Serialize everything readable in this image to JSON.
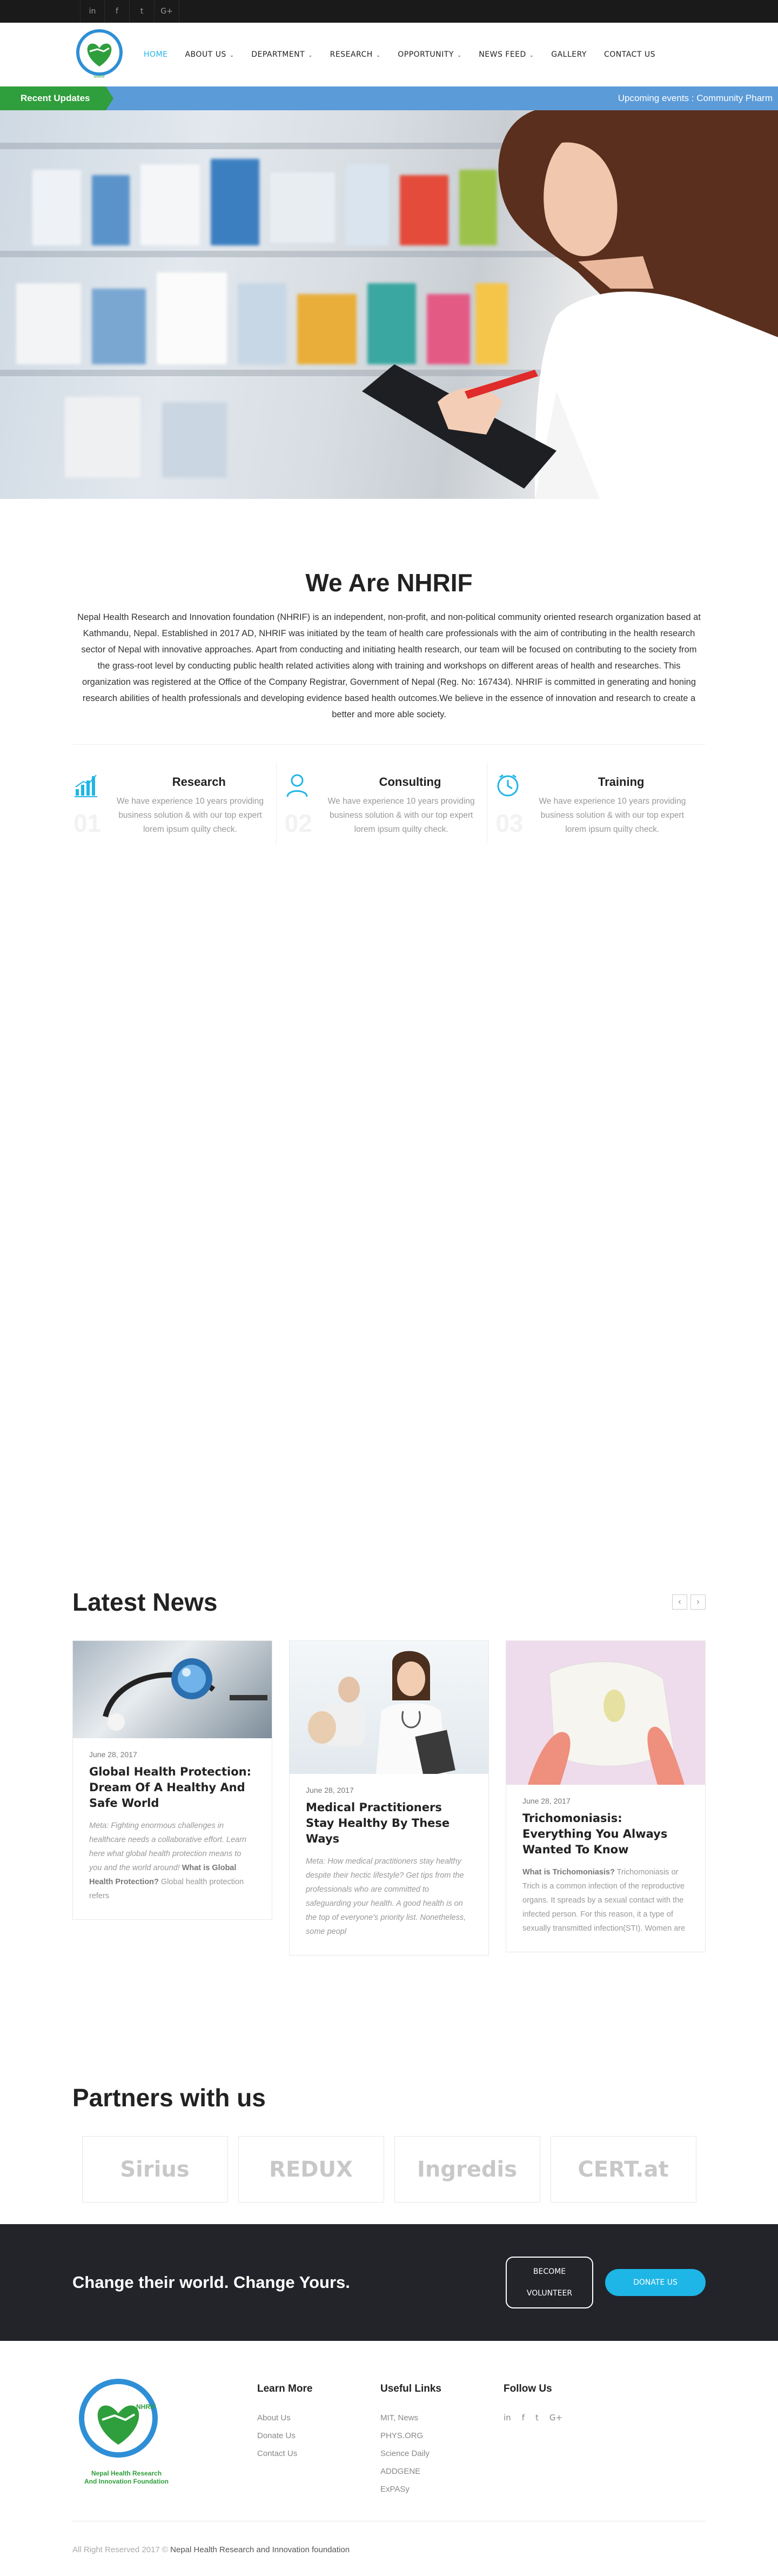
{
  "topbar": {
    "social": [
      {
        "icon": "linkedin-icon",
        "glyph": "in"
      },
      {
        "icon": "facebook-icon",
        "glyph": "f"
      },
      {
        "icon": "twitter-icon",
        "glyph": "t"
      },
      {
        "icon": "google-plus-icon",
        "glyph": "G+"
      }
    ]
  },
  "header": {
    "logo_text": "NHRIF",
    "nav": [
      {
        "label": "HOME",
        "caret": false,
        "active": true
      },
      {
        "label": "ABOUT US",
        "caret": true
      },
      {
        "label": "DEPARTMENT",
        "caret": true
      },
      {
        "label": "RESEARCH",
        "caret": true
      },
      {
        "label": "OPPORTUNITY",
        "caret": true
      },
      {
        "label": "NEWS FEED",
        "caret": true
      },
      {
        "label": "GALLERY",
        "caret": false
      },
      {
        "label": "CONTACT US",
        "caret": false
      }
    ]
  },
  "ticker": {
    "label": "Recent Updates",
    "text": "Upcoming events : Community Pharm"
  },
  "about": {
    "title": "We Are NHRIF",
    "text": "Nepal Health Research and Innovation foundation (NHRIF) is an independent, non-profit, and non-political community oriented research organization based at Kathmandu, Nepal.  Established in 2017 AD, NHRIF was initiated by the team of health care professionals with the aim of contributing in the health research sector of Nepal with innovative approaches. Apart from conducting and initiating health research, our team will be focused on contributing to the society from the grass-root level by conducting public health related activities along with training and workshops on different areas of health and researches. This organization was registered at the Office of the Company Registrar, Government of Nepal (Reg. No: 167434). NHRIF is committed in generating and honing research abilities of health professionals and developing evidence based health outcomes.We believe in the essence of innovation and research to create a better and more able society."
  },
  "services": [
    {
      "title": "Research",
      "num": "01",
      "icon": "chart-bars-icon",
      "text": "We have experience 10 years providing business solution & with our top expert lorem ipsum quilty check."
    },
    {
      "title": "Consulting",
      "num": "02",
      "icon": "user-icon",
      "text": "We have experience 10 years providing business solution & with our top expert lorem ipsum quilty check."
    },
    {
      "title": "Training",
      "num": "03",
      "icon": "clock-icon",
      "text": "We have experience 10 years providing business solution & with our top expert lorem ipsum quilty check."
    }
  ],
  "news": {
    "title": "Latest News",
    "prev": "‹",
    "next": "›",
    "cards": [
      {
        "date": "June 28, 2017",
        "title": "Global Health Protection: Dream Of A Healthy And Safe World",
        "text_italic": "Meta: Fighting enormous challenges in healthcare needs a collaborative effort. Learn here what global health protection means to you and the world around! ",
        "text_bold": "What is Global Health Protection?",
        "text_plain": " Global health protection refers"
      },
      {
        "date": "June 28, 2017",
        "title": "Medical Practitioners Stay Healthy By These Ways",
        "text_italic": "Meta: How medical practitioners stay healthy despite their hectic lifestyle? Get tips from the professionals who are committed to safeguarding your health. A good health is on the top of everyone's priority list. Nonetheless, some peopl",
        "text_bold": "",
        "text_plain": ""
      },
      {
        "date": "June 28, 2017",
        "title": "Trichomoniasis: Everything You Always Wanted To Know",
        "text_italic": "",
        "text_bold": "What is Trichomoniasis?",
        "text_plain": " Trichomoniasis or Trich is a common infection of the reproductive organs. It spreads by a sexual contact with the infected person. For this reason, it a type of sexually transmitted infection(STI). Women are"
      }
    ]
  },
  "partners": {
    "title": "Partners with us",
    "logos": [
      "Sirius",
      "REDUX",
      "Ingredis",
      "CERT.at"
    ]
  },
  "cta": {
    "title": "Change their world. Change Yours.",
    "volunteer_1": "BECOME",
    "volunteer_2": "VOLUNTEER",
    "donate": "DONATE US"
  },
  "footer": {
    "logo_line1": "Nepal Health Research",
    "logo_line2": "And Innovation Foundation",
    "learn": {
      "title": "Learn More",
      "links": [
        "About Us",
        "Donate Us",
        "Contact Us"
      ]
    },
    "useful": {
      "title": "Useful Links",
      "links": [
        "MIT, News",
        "PHYS.ORG",
        "Science Daily",
        "ADDGENE",
        "ExPASy"
      ]
    },
    "follow": {
      "title": "Follow Us"
    },
    "copyright": "All Right Reserved 2017 © ",
    "copyright_org": "Nepal Health Research and Innovation foundation"
  },
  "colors": {
    "accent": "#1eb6e6",
    "ticker_bg": "#5b9bd8",
    "ticker_label": "#2f9e3c",
    "cta_bg": "#22242a",
    "topbar": "#1a1a1a"
  }
}
